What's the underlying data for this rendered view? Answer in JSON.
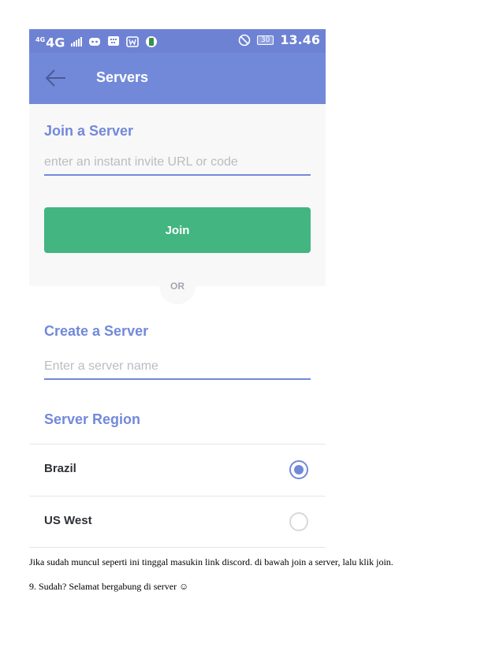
{
  "status_bar": {
    "network_small": "4G",
    "network": "4G",
    "battery": "30",
    "time": "13.46",
    "icons": [
      "signal-bars-icon",
      "discord-icon",
      "bbm-icon",
      "wechat-icon",
      "app-icon",
      "dnd-icon"
    ]
  },
  "toolbar": {
    "title": "Servers",
    "back_icon": "arrow-left-icon"
  },
  "join": {
    "title": "Join a Server",
    "placeholder": "enter an instant invite URL or code",
    "value": "",
    "button_label": "Join"
  },
  "or_label": "OR",
  "create": {
    "title": "Create a Server",
    "placeholder": "Enter a server name",
    "value": ""
  },
  "region": {
    "title": "Server Region",
    "options": [
      {
        "label": "Brazil",
        "selected": true
      },
      {
        "label": "US West",
        "selected": false
      }
    ]
  },
  "document": {
    "line1": "Jika sudah muncul seperti ini tinggal masukin link discord.  di bawah join a server, lalu klik join.",
    "line2": "9.  Sudah? Selamat bergabung di server ☺"
  },
  "colors": {
    "accent": "#7289da",
    "join_button": "#43b581"
  }
}
